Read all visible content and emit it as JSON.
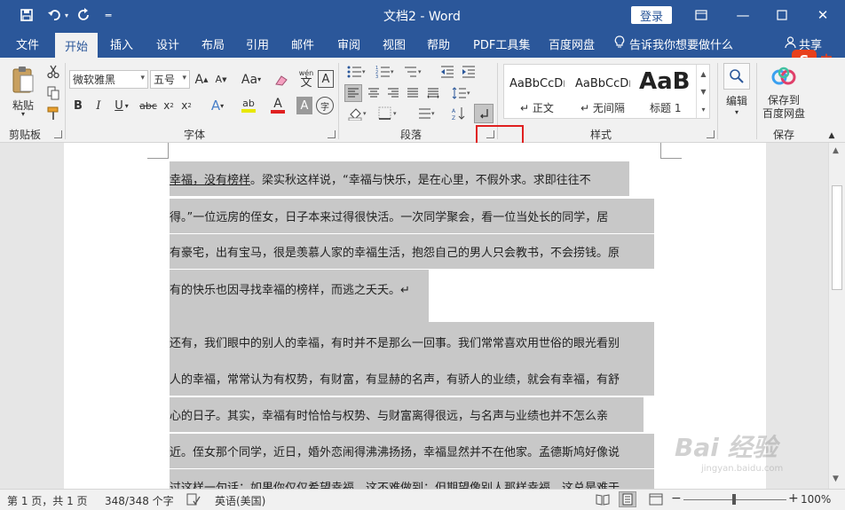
{
  "titlebar": {
    "title": "文档2 - Word",
    "login_label": "登录",
    "qat": {
      "save_icon": "save-icon",
      "undo_icon": "undo-icon",
      "redo_icon": "redo-icon",
      "customize_icon": "customize-icon"
    }
  },
  "tabs": [
    "文件",
    "开始",
    "插入",
    "设计",
    "布局",
    "引用",
    "邮件",
    "审阅",
    "视图",
    "帮助",
    "PDF工具集",
    "百度网盘"
  ],
  "tellme": "告诉我你想要做什么",
  "share": "共享",
  "ribbon": {
    "clipboard": {
      "paste_label": "粘贴",
      "group_label": "剪贴板"
    },
    "font": {
      "font_name": "微软雅黑",
      "font_size": "五号",
      "aa_label": "Aa",
      "wen_label": "wén",
      "wen_char": "文",
      "a_box": "A",
      "bold": "B",
      "italic": "I",
      "underline": "U",
      "strike": "abc",
      "sub": "x",
      "sup": "x",
      "sub_mark": "2",
      "sup_mark": "2",
      "effect": "A",
      "highlight": "ab",
      "fontcolor": "A",
      "shade": "A",
      "circle": "字",
      "grow": "A",
      "shrink": "A",
      "group_label": "字体"
    },
    "paragraph": {
      "group_label": "段落"
    },
    "styles": {
      "items": [
        {
          "sample": "AaBbCcDı",
          "name": "↵ 正文"
        },
        {
          "sample": "AaBbCcDı",
          "name": "↵ 无间隔"
        },
        {
          "sample": "AaBl",
          "name": "标题 1"
        }
      ],
      "group_label": "样式"
    },
    "editing": {
      "label": "编辑"
    },
    "save": {
      "label_line1": "保存到",
      "label_line2": "百度网盘",
      "group_label": "保存"
    }
  },
  "document": {
    "lines": [
      {
        "lead": "幸福，没有榜样",
        "text": "。梁实秋这样说，“幸福与快乐，是在心里，不假外求。求即往往不"
      },
      {
        "lead": "",
        "text": "得。”一位远房的侄女，日子本来过得很快活。一次同学聚会，看一位当处长的同学，居"
      },
      {
        "lead": "",
        "text": "有豪宅，出有宝马，很是羡慕人家的幸福生活，抱怨自己的男人只会教书，不会捞钱。原"
      },
      {
        "lead": "",
        "text": "有的快乐也因寻找幸福的榜样，而逃之夭夭。↵"
      },
      {
        "lead": "",
        "text": "还有，我们眼中的别人的幸福，有时并不是那么一回事。我们常常喜欢用世俗的眼光看别"
      },
      {
        "lead": "",
        "text": "人的幸福，常常认为有权势，有财富，有显赫的名声，有骄人的业绩，就会有幸福，有舒"
      },
      {
        "lead": "",
        "text": "心的日子。其实，幸福有时恰恰与权势、与财富离得很远，与名声与业绩也并不怎么亲"
      },
      {
        "lead": "",
        "text": "近。侄女那个同学，近日，婚外恋闹得沸沸扬扬，幸福显然并不在他家。孟德斯鸠好像说"
      },
      {
        "lead": "",
        "text": "过这样一句话：如果你仅仅希望幸福，这不难做到；但期望像别人那样幸福，这总是难于"
      }
    ]
  },
  "status": {
    "page": "第 1 页，共 1 页",
    "words": "348/348 个字",
    "lang": "英语(美国)",
    "zoom": "100%",
    "zoom_minus": "−",
    "zoom_plus": "+"
  },
  "watermark": {
    "text": "Bai 经验",
    "sub": "jingyan.baidu.com"
  },
  "colors": {
    "accent": "#2b579a",
    "highlight_bar": "#e8e800",
    "font_red": "#e02020",
    "red_box": "#e02020"
  }
}
